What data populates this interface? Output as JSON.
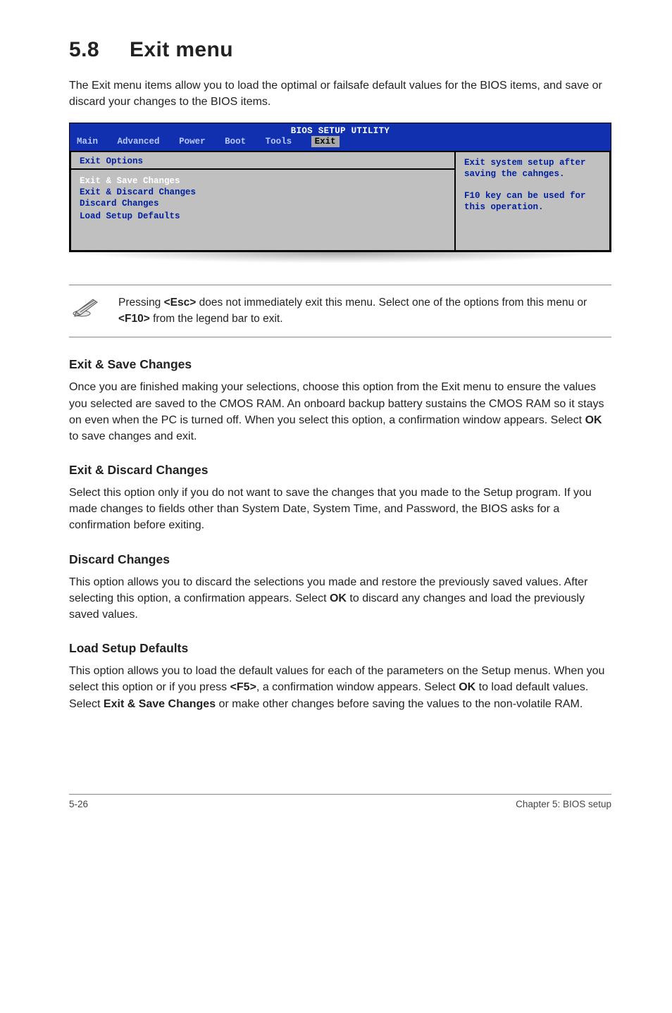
{
  "heading": {
    "num": "5.8",
    "title": "Exit menu"
  },
  "intro": "The Exit menu items allow you to load the optimal or failsafe default values for the BIOS items, and save or discard your changes to the BIOS items.",
  "bios": {
    "title": "BIOS SETUP UTILITY",
    "tabs": [
      "Main",
      "Advanced",
      "Power",
      "Boot",
      "Tools",
      "Exit"
    ],
    "options_header": "Exit Options",
    "items": [
      {
        "label": "Exit & Save Changes",
        "selected": true
      },
      {
        "label": "Exit & Discard Changes",
        "selected": false
      },
      {
        "label": "Discard Changes",
        "selected": false
      },
      {
        "label": "",
        "selected": false
      },
      {
        "label": "Load Setup Defaults",
        "selected": false
      }
    ],
    "help": "Exit system setup after saving the cahnges.\n\nF10 key can be used for this operation."
  },
  "note": {
    "text_pre": "Pressing ",
    "key1": "<Esc>",
    "text_mid": " does not immediately exit this menu. Select one of the options from this menu or ",
    "key2": "<F10>",
    "text_post": " from the legend bar to exit."
  },
  "sections": {
    "s1": {
      "h": "Exit & Save Changes",
      "p_pre": "Once you are finished making your selections, choose this option from the Exit menu to ensure the values you selected are saved to the CMOS RAM. An onboard backup battery sustains the CMOS RAM so it stays on even when the PC is turned off. When you select this option, a confirmation window appears. Select ",
      "p_b1": "OK",
      "p_post": " to save changes and exit."
    },
    "s2": {
      "h": "Exit & Discard Changes",
      "p": "Select this option only if you do not want to save the changes that you made to the Setup program. If you made changes to fields other than System Date, System Time, and Password, the BIOS asks for a confirmation before exiting."
    },
    "s3": {
      "h": "Discard Changes",
      "p_pre": "This option allows you to discard the selections you made and restore the previously saved values. After selecting this option, a confirmation appears. Select ",
      "p_b1": "OK",
      "p_post": " to discard any changes and load the previously saved values."
    },
    "s4": {
      "h": "Load Setup Defaults",
      "p_pre": "This option allows you to load the default values for each of the parameters on the Setup menus. When you select this option or if you press ",
      "p_b1": "<F5>",
      "p_mid1": ", a confirmation window appears. Select ",
      "p_b2": "OK",
      "p_mid2": " to load default values. Select ",
      "p_b3": "Exit & Save Changes",
      "p_post": " or make other changes before saving the values to the non-volatile RAM."
    }
  },
  "footer": {
    "left": "5-26",
    "right": "Chapter 5: BIOS setup"
  }
}
